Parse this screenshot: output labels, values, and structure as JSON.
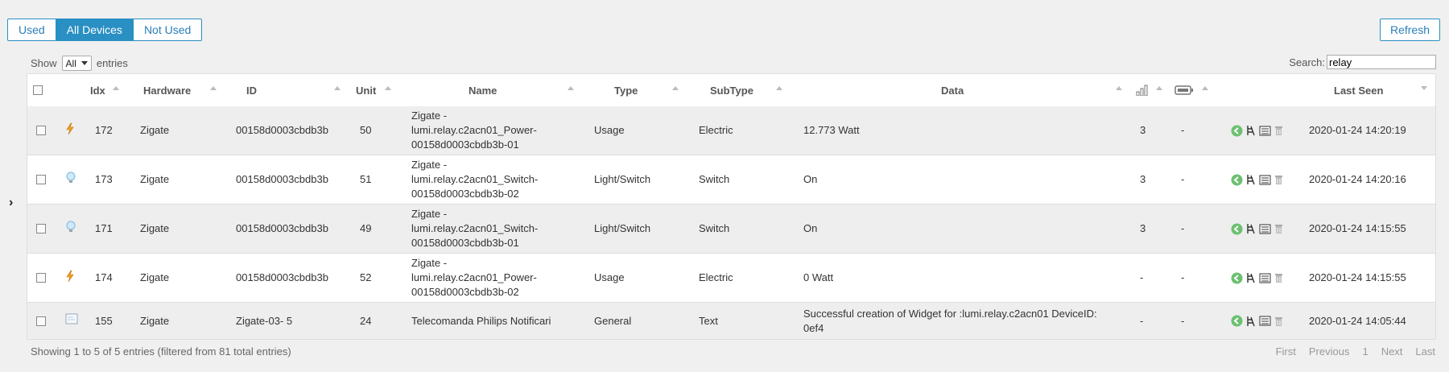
{
  "filters": {
    "used": "Used",
    "all": "All Devices",
    "not_used": "Not Used"
  },
  "refresh": "Refresh",
  "show": {
    "prefix": "Show",
    "value": "All",
    "suffix": "entries"
  },
  "search": {
    "label": "Search:",
    "value": "relay"
  },
  "columns": {
    "idx": "Idx",
    "hardware": "Hardware",
    "id": "ID",
    "unit": "Unit",
    "name": "Name",
    "type": "Type",
    "subtype": "SubType",
    "data": "Data",
    "last_seen": "Last Seen"
  },
  "rows": [
    {
      "icon": "lightning-icon",
      "idx": "172",
      "hardware": "Zigate",
      "id": "00158d0003cbdb3b",
      "unit": "50",
      "name_l1": "Zigate -",
      "name_l2": "lumi.relay.c2acn01_Power-",
      "name_l3": "00158d0003cbdb3b-01",
      "type": "Usage",
      "subtype": "Electric",
      "data": "12.773 Watt",
      "data_l2": "",
      "signal": "3",
      "battery": "-",
      "last_seen": "2020-01-24 14:20:19"
    },
    {
      "icon": "bulb-icon",
      "idx": "173",
      "hardware": "Zigate",
      "id": "00158d0003cbdb3b",
      "unit": "51",
      "name_l1": "Zigate -",
      "name_l2": "lumi.relay.c2acn01_Switch-",
      "name_l3": "00158d0003cbdb3b-02",
      "type": "Light/Switch",
      "subtype": "Switch",
      "data": "On",
      "data_l2": "",
      "signal": "3",
      "battery": "-",
      "last_seen": "2020-01-24 14:20:16"
    },
    {
      "icon": "bulb-icon",
      "idx": "171",
      "hardware": "Zigate",
      "id": "00158d0003cbdb3b",
      "unit": "49",
      "name_l1": "Zigate -",
      "name_l2": "lumi.relay.c2acn01_Switch-",
      "name_l3": "00158d0003cbdb3b-01",
      "type": "Light/Switch",
      "subtype": "Switch",
      "data": "On",
      "data_l2": "",
      "signal": "3",
      "battery": "-",
      "last_seen": "2020-01-24 14:15:55"
    },
    {
      "icon": "lightning-icon",
      "idx": "174",
      "hardware": "Zigate",
      "id": "00158d0003cbdb3b",
      "unit": "52",
      "name_l1": "Zigate -",
      "name_l2": "lumi.relay.c2acn01_Power-",
      "name_l3": "00158d0003cbdb3b-02",
      "type": "Usage",
      "subtype": "Electric",
      "data": "0 Watt",
      "data_l2": "",
      "signal": "-",
      "battery": "-",
      "last_seen": "2020-01-24 14:15:55"
    },
    {
      "icon": "text-icon",
      "idx": "155",
      "hardware": "Zigate",
      "id": "Zigate-03- 5",
      "unit": "24",
      "name_l1": "",
      "name_l2": "Telecomanda Philips Notificari",
      "name_l3": "",
      "type": "General",
      "subtype": "Text",
      "data": "Successful creation of Widget for :lumi.relay.c2acn01 DeviceID:",
      "data_l2": "0ef4",
      "signal": "-",
      "battery": "-",
      "last_seen": "2020-01-24 14:05:44"
    }
  ],
  "footer": {
    "info": "Showing 1 to 5 of 5 entries (filtered from 81 total entries)"
  },
  "pager": {
    "first": "First",
    "previous": "Previous",
    "page": "1",
    "next": "Next",
    "last": "Last"
  },
  "colors": {
    "accent": "#2a8fc3",
    "row_alt": "#eeeeee",
    "action_green": "#5cb85c"
  }
}
